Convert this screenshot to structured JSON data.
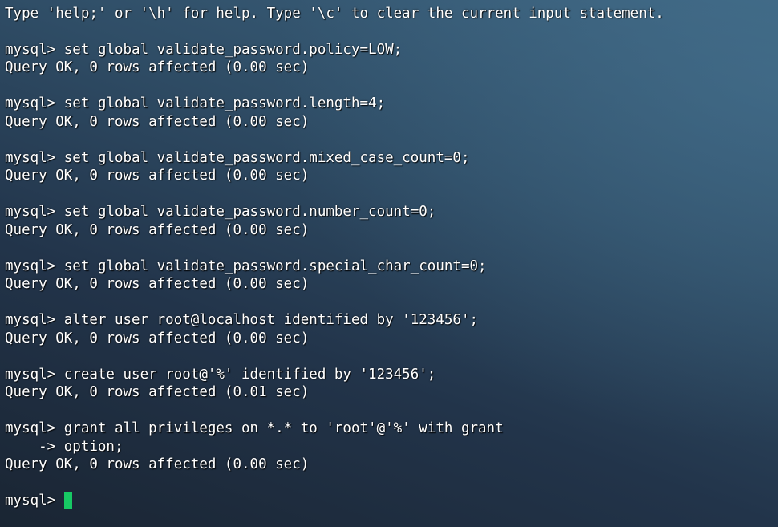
{
  "app": {
    "type": "terminal",
    "program": "mysql"
  },
  "colors": {
    "text": "#ffffff",
    "cursor": "#17c964",
    "background_dark": "#1a2533",
    "background_light": "#3d6480"
  },
  "terminal": {
    "lines": [
      "Type 'help;' or '\\h' for help. Type '\\c' to clear the current input statement.",
      "",
      "mysql> set global validate_password.policy=LOW;",
      "Query OK, 0 rows affected (0.00 sec)",
      "",
      "mysql> set global validate_password.length=4;",
      "Query OK, 0 rows affected (0.00 sec)",
      "",
      "mysql> set global validate_password.mixed_case_count=0;",
      "Query OK, 0 rows affected (0.00 sec)",
      "",
      "mysql> set global validate_password.number_count=0;",
      "Query OK, 0 rows affected (0.00 sec)",
      "",
      "mysql> set global validate_password.special_char_count=0;",
      "Query OK, 0 rows affected (0.00 sec)",
      "",
      "mysql> alter user root@localhost identified by '123456';",
      "Query OK, 0 rows affected (0.00 sec)",
      "",
      "mysql> create user root@'%' identified by '123456';",
      "Query OK, 0 rows affected (0.01 sec)",
      "",
      "mysql> grant all privileges on *.* to 'root'@'%' with grant",
      "    -> option;",
      "Query OK, 0 rows affected (0.00 sec)",
      "",
      "mysql> "
    ]
  }
}
